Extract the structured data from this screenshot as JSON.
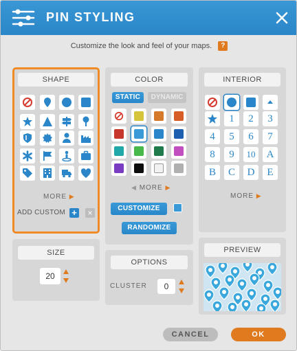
{
  "header": {
    "title": "PIN STYLING"
  },
  "subtitle": {
    "text": "Customize the look and feel of your maps.",
    "help": "?"
  },
  "shape": {
    "title": "SHAPE",
    "icons": [
      "no-icon",
      "pin-icon",
      "circle-icon",
      "square-icon",
      "star-icon",
      "triangle-icon",
      "signpost-icon",
      "map-pin-icon",
      "shield-icon",
      "badge-icon",
      "person-icon",
      "factory-icon",
      "asterisk-icon",
      "flag-icon",
      "person-marker-icon",
      "briefcase-icon",
      "tag-icon",
      "building-icon",
      "truck-icon",
      "heart-icon"
    ],
    "more": "MORE",
    "add_custom": "ADD CUSTOM",
    "add_icon": "+",
    "remove_icon": "×"
  },
  "size": {
    "title": "SIZE",
    "value": "20"
  },
  "color": {
    "title": "COLOR",
    "tab_static": "STATIC",
    "tab_dynamic": "DYNAMIC",
    "swatches": [
      "none",
      "#d6c43a",
      "#d47a2a",
      "#d65d25",
      "#c8372b",
      "#3a9ad8",
      "#2a86c8",
      "#1f5fb0",
      "#22a8a8",
      "#48b84a",
      "#1f7a4c",
      "#c24fc0",
      "#7a3cc0",
      "#0d0d0d",
      "#f2f2f2",
      "#b0b0b0"
    ],
    "selected": 5,
    "more": "MORE",
    "customize": "CUSTOMIZE",
    "customize_color": "#3a9ad8",
    "randomize": "RANDOMIZE"
  },
  "options": {
    "title": "OPTIONS",
    "cluster_label": "CLUSTER",
    "cluster_value": "0"
  },
  "interior": {
    "title": "INTERIOR",
    "labels": [
      "1",
      "2",
      "3",
      "4",
      "5",
      "6",
      "7",
      "8",
      "9",
      "10",
      "A",
      "B",
      "C",
      "D",
      "E"
    ],
    "more": "MORE"
  },
  "preview": {
    "title": "PREVIEW"
  },
  "footer": {
    "cancel": "CANCEL",
    "ok": "OK"
  },
  "colors": {
    "accent": "#2a86c8",
    "orange": "#e07a1e",
    "panel": "#d7d7d7"
  }
}
